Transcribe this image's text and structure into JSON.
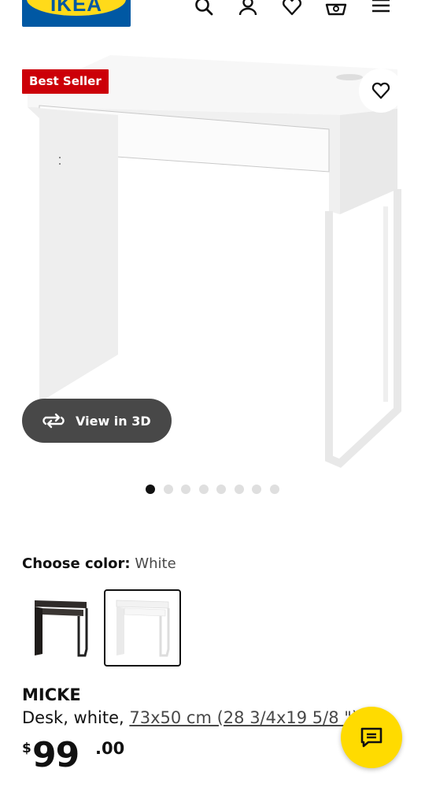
{
  "header": {
    "logo_text": "IKEA",
    "icons": [
      "search-icon",
      "account-icon",
      "heart-icon",
      "cart-icon",
      "menu-icon"
    ]
  },
  "gallery": {
    "badge": "Best Seller",
    "view_3d_label": "View in 3D",
    "image_count": 8,
    "active_image_index": 0
  },
  "color": {
    "label": "Choose color:",
    "selected": "White",
    "options": [
      "black-brown",
      "white"
    ]
  },
  "product": {
    "name": "MICKE",
    "desc_prefix": "Desk, white, ",
    "dimensions": "73x50 cm (28 3/4x19 5/8 \")",
    "price_currency": "$",
    "price_integer": "99",
    "price_decimal": ".00"
  },
  "colors": {
    "brand_blue": "#0058a3",
    "brand_yellow": "#ffda1a",
    "badge_red": "#cc0008",
    "chat_yellow": "#ffdb00"
  }
}
